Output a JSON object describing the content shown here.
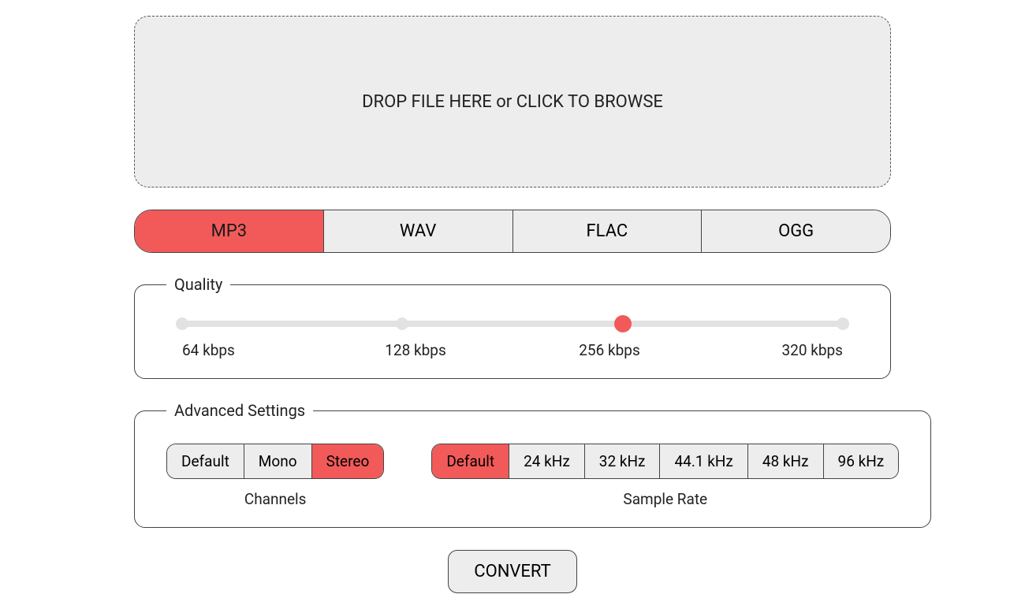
{
  "dropzone": {
    "text": "DROP FILE HERE or CLICK TO BROWSE"
  },
  "formats": {
    "options": [
      "MP3",
      "WAV",
      "FLAC",
      "OGG"
    ],
    "active_index": 0
  },
  "quality": {
    "legend": "Quality",
    "stops": [
      "64 kbps",
      "128 kbps",
      "256 kbps",
      "320 kbps"
    ],
    "active_index": 2
  },
  "advanced": {
    "legend": "Advanced Settings",
    "channels": {
      "label": "Channels",
      "options": [
        "Default",
        "Mono",
        "Stereo"
      ],
      "active_index": 2
    },
    "sample_rate": {
      "label": "Sample Rate",
      "options": [
        "Default",
        "24 kHz",
        "32 kHz",
        "44.1 kHz",
        "48 kHz",
        "96 kHz"
      ],
      "active_index": 0
    }
  },
  "convert": {
    "label": "CONVERT"
  },
  "colors": {
    "accent": "#f25a5a"
  }
}
